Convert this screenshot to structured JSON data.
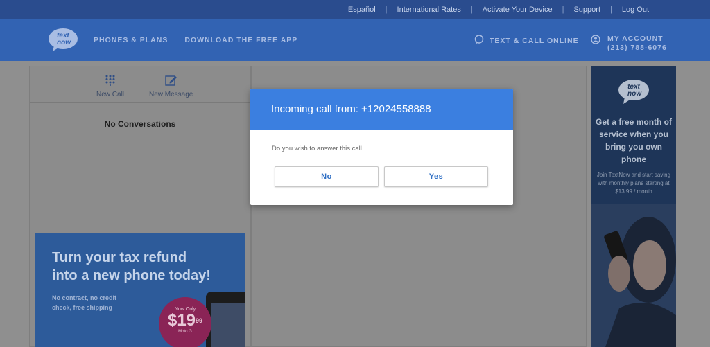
{
  "topbar": {
    "links": [
      "Español",
      "International Rates",
      "Activate Your Device",
      "Support",
      "Log Out"
    ]
  },
  "header": {
    "logo_text": "TextNow",
    "nav": [
      "PHONES & PLANS",
      "DOWNLOAD THE FREE APP"
    ],
    "text_call": "TEXT & CALL ONLINE",
    "account_label": "MY ACCOUNT",
    "account_number": "(213) 788-6076"
  },
  "sidebar": {
    "new_call": "New Call",
    "new_message": "New Message",
    "empty_state": "No Conversations"
  },
  "ad_left": {
    "headline_1": "Turn your tax refund",
    "headline_2": "into a new phone today!",
    "sub_1": "No contract, no credit",
    "sub_2": "check, free shipping",
    "badge_top": "Now Only",
    "badge_price": "$19",
    "badge_cents": "99",
    "badge_model": "Moto G"
  },
  "ad_right": {
    "logo_text": "TextNow",
    "headline": "Get a free month of service when you bring you own phone",
    "sub": "Join TextNow and start saving with monthly plans starting at $13.99 / month"
  },
  "modal": {
    "title": "Incoming call from: +12024558888",
    "message": "Do you wish to answer this call",
    "no_label": "No",
    "yes_label": "Yes"
  },
  "colors": {
    "topbar": "#2a4c8e",
    "header": "#3263b3",
    "modal_header": "#3b7fe0",
    "button_text": "#2f6fc4"
  }
}
